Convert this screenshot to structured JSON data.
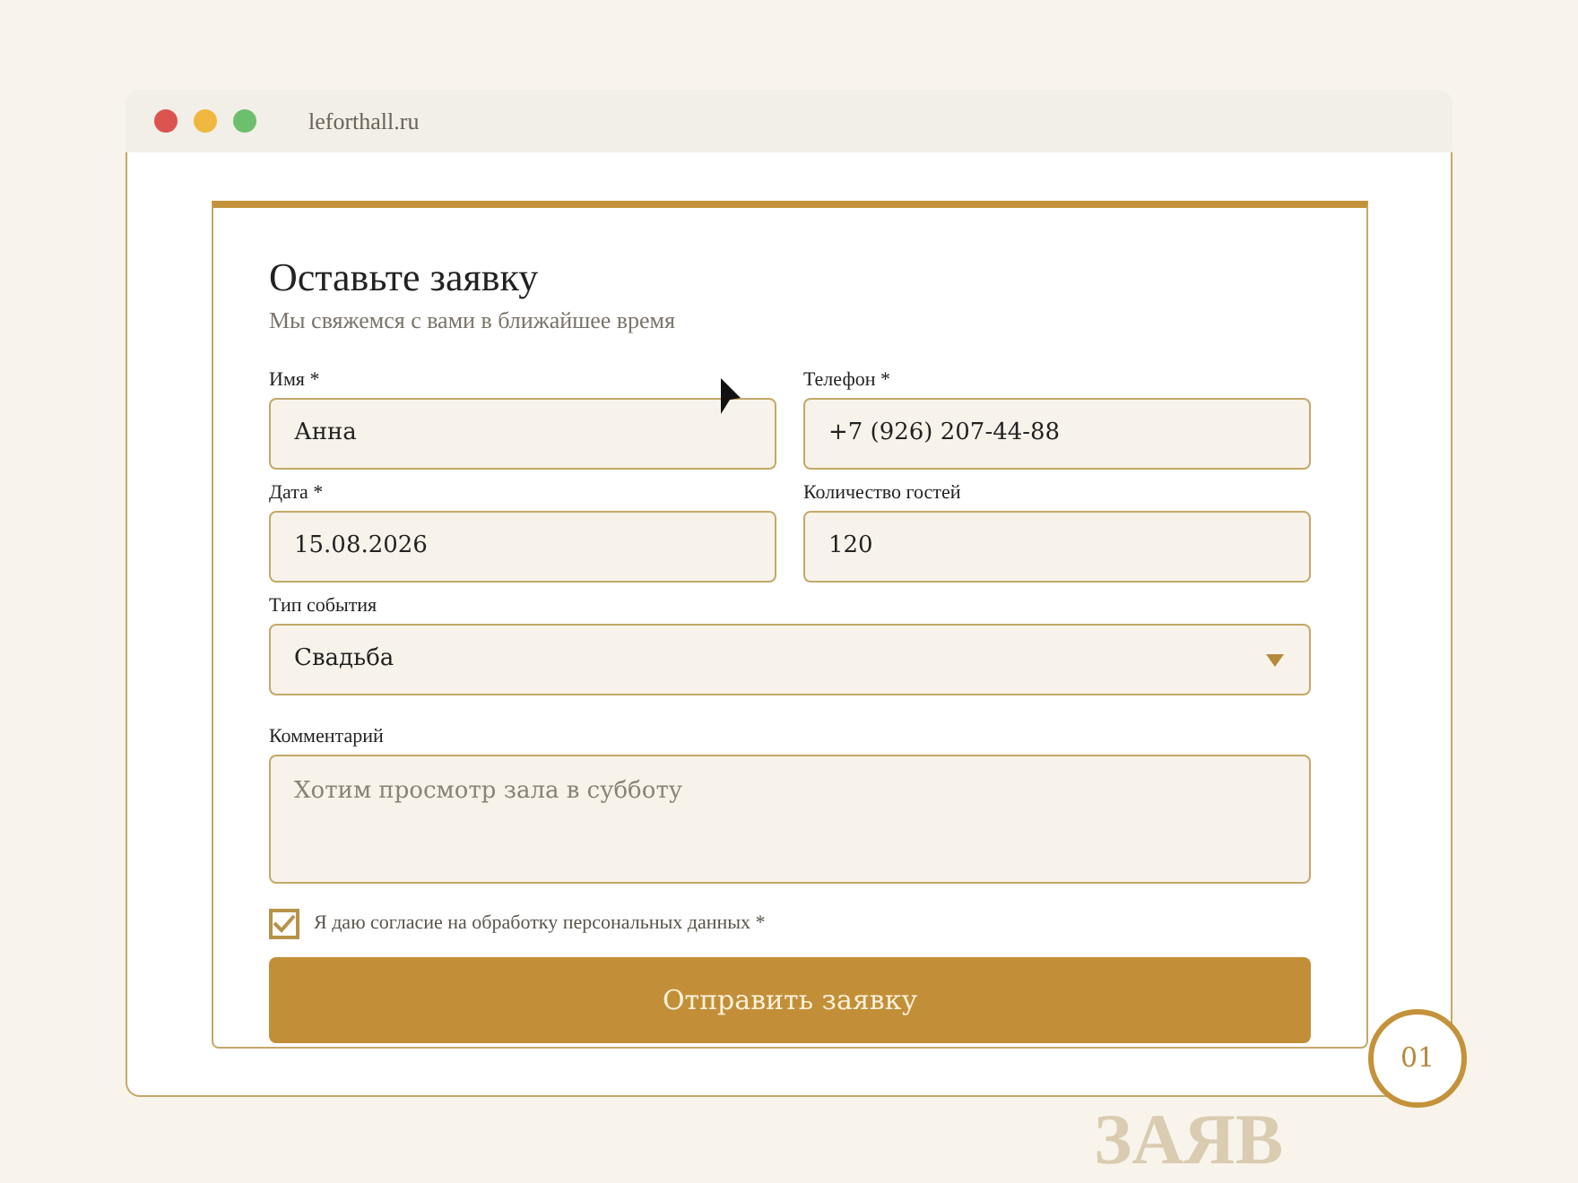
{
  "browser": {
    "url": "leforthall.ru"
  },
  "form": {
    "title": "Оставьте заявку",
    "subtitle": "Мы свяжемся с вами в ближайшее время",
    "rows": [
      [
        {
          "kind": "input",
          "label": "Имя *",
          "value": "Анна"
        },
        {
          "kind": "input",
          "label": "Телефон *",
          "value": "+7 (926) 207-44-88"
        }
      ],
      [
        {
          "kind": "input",
          "label": "Дата *",
          "value": "15.08.2026"
        },
        {
          "kind": "input",
          "label": "Количество гостей",
          "value": "120"
        }
      ],
      [
        {
          "kind": "select",
          "label": "Тип события",
          "value": "Свадьба"
        }
      ],
      [
        {
          "kind": "textarea",
          "label": "Комментарий",
          "placeholder": "Хотим просмотр зала в субботу"
        }
      ]
    ],
    "consent": {
      "label": "Я даю согласие на обработку персональных данных *",
      "checked": true
    },
    "submit": "Отправить заявку"
  },
  "badge": "01",
  "background_word": "ЗАЯВ"
}
